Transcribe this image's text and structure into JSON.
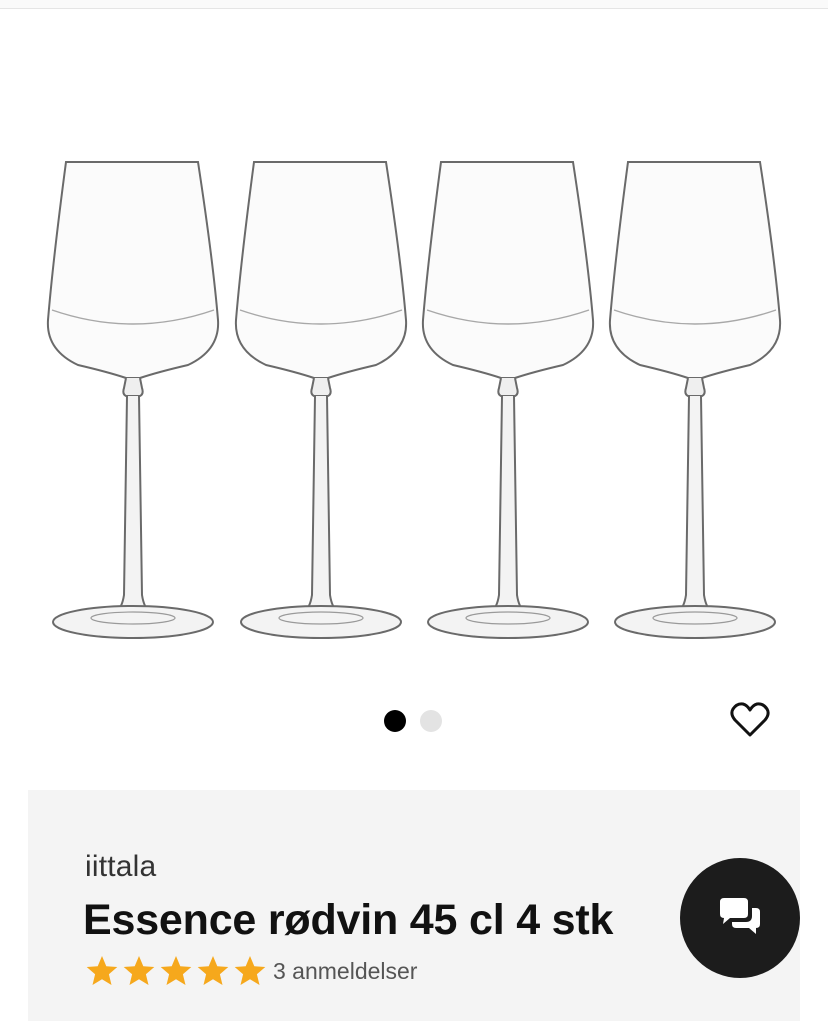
{
  "colors": {
    "info_background": "#f4f4f4",
    "star": "#f6a81c",
    "dot_active": "#000000",
    "dot_inactive": "#e3e3e3",
    "chat_background": "#1c1c1c"
  },
  "gallery": {
    "image_alt": "Essence rødvin 45 cl 4 stk",
    "glass_count": 4,
    "slide_count": 2,
    "active_slide": 1
  },
  "favorite": {
    "icon": "heart-outline-icon"
  },
  "product": {
    "brand": "iittala",
    "title": "Essence rødvin 45 cl 4 stk",
    "rating": 5,
    "reviews_text": "3 anmeldelser"
  },
  "chat": {
    "icon": "chat-bubbles-icon"
  }
}
